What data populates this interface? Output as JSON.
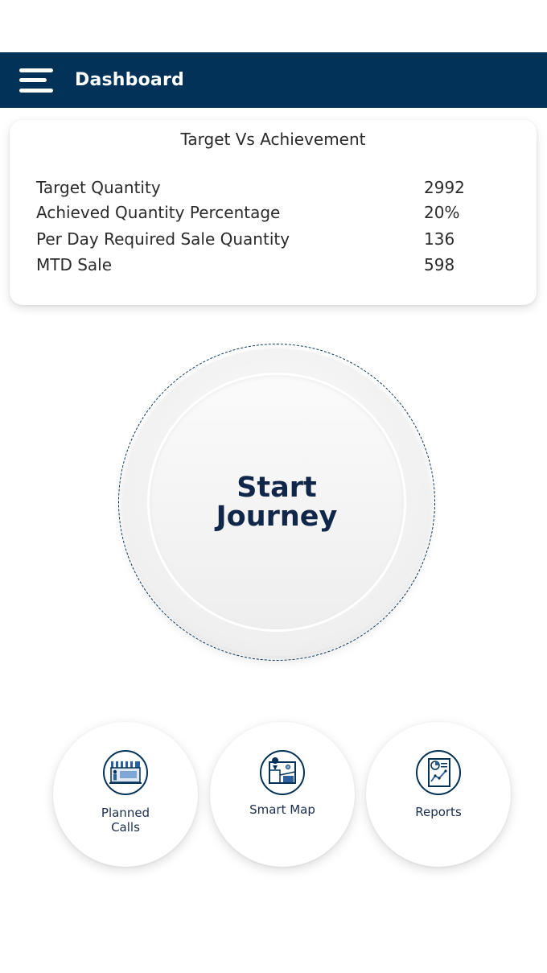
{
  "header": {
    "title": "Dashboard",
    "menu_icon": "hamburger-menu-icon",
    "background_color": "#033258"
  },
  "target_card": {
    "heading": "Target Vs Achievement",
    "metrics": [
      {
        "label": "Target Quantity",
        "value": "2992"
      },
      {
        "label": "Achieved Quantity Percentage",
        "value": "20%"
      },
      {
        "label": "Per Day Required Sale Quantity",
        "value": "136"
      },
      {
        "label": "MTD Sale",
        "value": "598"
      }
    ]
  },
  "journey": {
    "line1": "Start",
    "line2": "Journey",
    "text_color": "#11274a"
  },
  "actions": [
    {
      "label_line1": "Planned",
      "label_line2": "Calls",
      "icon": "storefront-icon"
    },
    {
      "label_line1": "Smart Map",
      "icon": "map-icon"
    },
    {
      "label_line1": "Reports",
      "icon": "report-chart-icon"
    }
  ]
}
